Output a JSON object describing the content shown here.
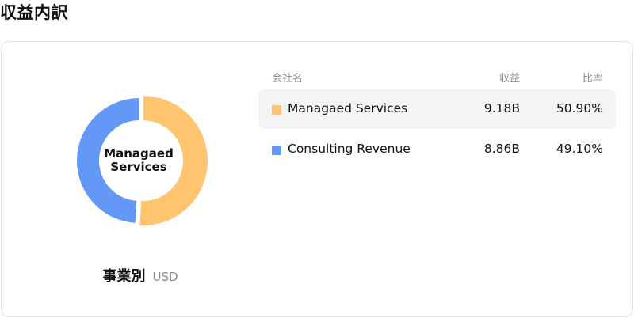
{
  "page": {
    "title": "収益内訳"
  },
  "donut": {
    "center_line1": "Managaed",
    "center_line2": "Services"
  },
  "caption": {
    "label": "事業別",
    "unit": "USD"
  },
  "table": {
    "headers": {
      "company": "会社名",
      "revenue": "収益",
      "ratio": "比率"
    },
    "rows": [
      {
        "name": "Managaed Services",
        "value": "9.18B",
        "percent": "50.90%",
        "color": "#ffc46e",
        "highlighted": true
      },
      {
        "name": "Consulting Revenue",
        "value": "8.86B",
        "percent": "49.10%",
        "color": "#6398f7",
        "highlighted": false
      }
    ]
  },
  "chart_data": {
    "type": "pie",
    "donut": true,
    "categories": [
      "Managaed Services",
      "Consulting Revenue"
    ],
    "values": [
      9.18,
      8.86
    ],
    "percent": [
      50.9,
      49.1
    ],
    "unit": "USD",
    "colors": [
      "#ffc46e",
      "#6398f7"
    ],
    "highlighted": "Managaed Services",
    "title": "収益内訳"
  }
}
